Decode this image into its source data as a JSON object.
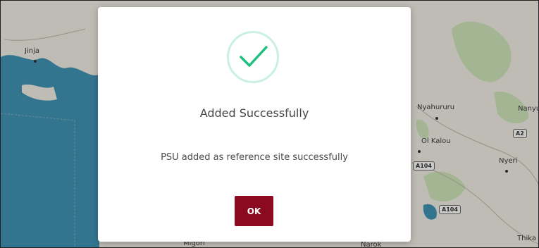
{
  "map": {
    "places": {
      "jinja": "Jinja",
      "nyahururu": "Nyahururu",
      "nanyuki": "Nanyuki",
      "ol_kalou": "Ol Kalou",
      "nyeri": "Nyeri",
      "migori": "Migori",
      "narok": "Narok",
      "thika": "Thika"
    },
    "roads": {
      "a2": "A2",
      "a104_top": "A104",
      "a104_bottom": "A104"
    },
    "colors": {
      "land": "#e9e6dd",
      "water": "#3f8fae",
      "park": "#c8ddb4"
    }
  },
  "dialog": {
    "icon": "check-circle-icon",
    "title": "Added Successfully",
    "message": "PSU added as reference site successfully",
    "ok_label": "OK",
    "colors": {
      "check": "#1fbf82",
      "ring": "#c9f0e2",
      "button": "#8b0a1f"
    }
  }
}
